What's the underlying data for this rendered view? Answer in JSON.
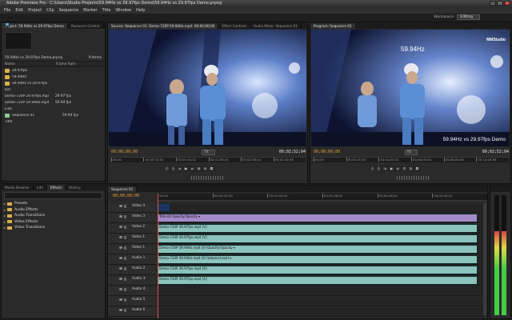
{
  "window": {
    "title": "Adobe Premiere Pro - C:\\Users\\Studio Projects\\59.94Hz vs 29.97fps Demo\\59.94Hz vs 29.97fps Demo.prproj",
    "buttons": [
      "_",
      "□",
      "×"
    ]
  },
  "menu": [
    "File",
    "Edit",
    "Project",
    "Clip",
    "Sequence",
    "Marker",
    "Title",
    "Window",
    "Help"
  ],
  "workspace": {
    "label": "Workspace:",
    "value": "Editing"
  },
  "project_panel": {
    "tabs": [
      "Project: 59.94Hz vs 29.97fps Demo",
      "Resource Central"
    ],
    "project_name": "59.94Hz vs 29.97fps Demo.prproj",
    "item_count": "9 Items",
    "col_name": "Name",
    "col_rate": "Frame Rate",
    "items": [
      {
        "name": "29.97fps",
        "rate": "",
        "kind": "folder"
      },
      {
        "name": "59.94Hz",
        "rate": "",
        "kind": "folder"
      },
      {
        "name": "59.94Hz vs 29.97fps",
        "rate": "",
        "kind": "folder"
      },
      {
        "name": "Bar",
        "rate": "",
        "kind": "clip"
      },
      {
        "name": "Demo-720P 29.97fps.mp4",
        "rate": "29.97 fps",
        "kind": "clip"
      },
      {
        "name": "Demo-720P 59.94Hz.mp4",
        "rate": "59.94 fps",
        "kind": "clip"
      },
      {
        "name": "Line",
        "rate": "",
        "kind": "clip"
      },
      {
        "name": "Sequence 01",
        "rate": "59.94 fps",
        "kind": "seq"
      },
      {
        "name": "Title",
        "rate": "",
        "kind": "clip"
      }
    ]
  },
  "effects_panel": {
    "tabs": [
      "Media Browser",
      "Info",
      "Effects",
      "History"
    ],
    "items": [
      "Presets",
      "Audio Effects",
      "Audio Transitions",
      "Video Effects",
      "Video Transitions"
    ]
  },
  "source_monitor": {
    "tabs": [
      "Source: Sequence 01: Demo-720P 59.94Hz.mp4: 00;00;00;00",
      "Effect Controls",
      "Audio Mixer: Sequence 01"
    ],
    "timecode_in": "00;00;00;00",
    "fit": "Fit",
    "timecode_dur": "00;02;52;04",
    "ruler": [
      "00;00",
      "00;00;32;00",
      "00;01;04;02",
      "00;01;36;04",
      "00;02;08;04",
      "00;02;40;06"
    ]
  },
  "program_monitor": {
    "tabs": [
      "Program: Sequence 01"
    ],
    "overlay_top": "59.94Hz",
    "overlay_logo": "MMStudio",
    "overlay_bottom": "59.94Hz vs 29.97fps Demo",
    "timecode_in": "00;00;00;00",
    "fit": "Fit",
    "timecode_dur": "00;02;52;04",
    "ruler": [
      "00;00",
      "00;02;00;00",
      "00;04;00;02",
      "00;06;00;04",
      "00;08;00;06",
      "00;10;00;08"
    ]
  },
  "timeline": {
    "tab": "Sequence 01",
    "timecode": "00;00;00;00",
    "ruler": [
      "00;00",
      "00;00;32;00",
      "00;01;04;02",
      "00;01;36;02",
      "00;02;08;04",
      "00;02;40;04"
    ],
    "tracks": [
      {
        "name": "Video 4",
        "kind": "v",
        "clips": [
          {
            "label": "",
            "kind": "thumb",
            "start": 0.0,
            "end": 0.04
          }
        ]
      },
      {
        "name": "Video 3",
        "kind": "v",
        "clips": [
          {
            "label": "Title.02 Opacity:Opacity ▾",
            "kind": "title",
            "start": 0.0,
            "end": 1.0
          }
        ]
      },
      {
        "name": "Video 2",
        "kind": "v",
        "clips": [
          {
            "label": "Demo-720P 29.97fps.mp4 [V]",
            "kind": "v",
            "start": 0.0,
            "end": 1.0
          }
        ]
      },
      {
        "name": "Video 1",
        "kind": "v",
        "clips": [
          {
            "label": "Demo-720P 29.97fps.mp4 [V]",
            "kind": "v",
            "start": 0.0,
            "end": 1.0
          }
        ]
      },
      {
        "name": "Video 1",
        "kind": "v2",
        "clips": [
          {
            "label": "Demo-720P 59.94Hz.mp4 [V] Opacity:Opacity ▾",
            "kind": "v",
            "start": 0.0,
            "end": 1.0
          }
        ]
      },
      {
        "name": "Audio 1",
        "kind": "a",
        "clips": [
          {
            "label": "Demo-720P 59.94Hz.mp4 [A] Volume:Level ▾",
            "kind": "a",
            "start": 0.0,
            "end": 1.0
          }
        ]
      },
      {
        "name": "Audio 2",
        "kind": "a",
        "clips": [
          {
            "label": "Demo-720P 29.97fps.mp4 [A]",
            "kind": "a",
            "start": 0.0,
            "end": 1.0
          }
        ]
      },
      {
        "name": "Audio 3",
        "kind": "a",
        "clips": [
          {
            "label": "Demo-720P 29.97fps.mp4 [A]",
            "kind": "a",
            "start": 0.0,
            "end": 1.0
          }
        ]
      },
      {
        "name": "Audio 4",
        "kind": "a",
        "clips": []
      },
      {
        "name": "Audio 5",
        "kind": "a",
        "clips": []
      },
      {
        "name": "Audio 6",
        "kind": "a",
        "clips": []
      }
    ]
  },
  "colors": {
    "timecode": "#e3a23a",
    "clip": "#8cc3bd",
    "title_clip": "#a48ac8",
    "playhead": "#e05050"
  }
}
